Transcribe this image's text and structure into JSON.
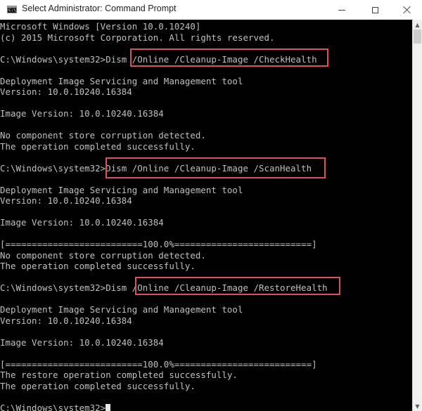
{
  "window": {
    "title": "Select Administrator: Command Prompt",
    "icon": "cmd-icon",
    "icon_text": "C:\\_",
    "controls": {
      "minimize": "minimize-icon",
      "maximize": "maximize-icon",
      "close": "close-icon"
    }
  },
  "console": {
    "lines": [
      "Microsoft Windows [Version 10.0.10240]",
      "(c) 2015 Microsoft Corporation. All rights reserved.",
      "",
      "C:\\Windows\\system32>Dism /Online /Cleanup-Image /CheckHealth",
      "",
      "Deployment Image Servicing and Management tool",
      "Version: 10.0.10240.16384",
      "",
      "Image Version: 10.0.10240.16384",
      "",
      "No component store corruption detected.",
      "The operation completed successfully.",
      "",
      "C:\\Windows\\system32>Dism /Online /Cleanup-Image /ScanHealth",
      "",
      "Deployment Image Servicing and Management tool",
      "Version: 10.0.10240.16384",
      "",
      "Image Version: 10.0.10240.16384",
      "",
      "[==========================100.0%==========================]",
      "No component store corruption detected.",
      "The operation completed successfully.",
      "",
      "C:\\Windows\\system32>Dism /Online /Cleanup-Image /RestoreHealth",
      "",
      "Deployment Image Servicing and Management tool",
      "Version: 10.0.10240.16384",
      "",
      "Image Version: 10.0.10240.16384",
      "",
      "[==========================100.0%==========================]",
      "The restore operation completed successfully.",
      "The operation completed successfully.",
      "",
      "C:\\Windows\\system32>"
    ],
    "highlighted_commands": [
      "/Online /Cleanup-Image /CheckHealth",
      "Dism /Online /Cleanup-Image /ScanHealth",
      "/Online /Cleanup-Image /RestoreHealth"
    ],
    "scan_progress_percent": 100.0,
    "restore_progress_percent": 100.0
  },
  "colors": {
    "console_bg": "#000000",
    "console_fg": "#c0c0c0",
    "highlight_border": "#d9535c",
    "titlebar_bg": "#ffffff"
  },
  "scrollbar": {
    "up_arrow": "^",
    "down_arrow": "v"
  }
}
